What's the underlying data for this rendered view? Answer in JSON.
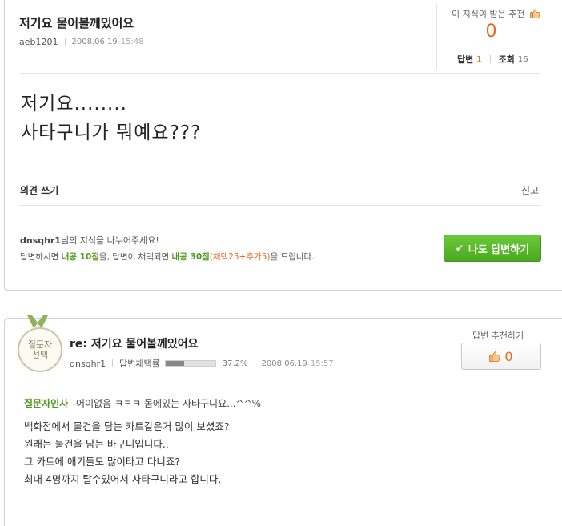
{
  "question": {
    "title": "저기요 물어볼께있어요",
    "author": "aeb1201",
    "date": "2008.06.19",
    "time": "15:48",
    "recommend_label": "이 지식이 받은 추천",
    "recommend_count": "0",
    "answers_label": "답변",
    "answers_count": "1",
    "views_label": "조회",
    "views_count": "16",
    "body_lines": [
      "저기요........",
      "사타구니가 뭐예요???"
    ],
    "opinion_link": "의견 쓰기",
    "report_link": "신고",
    "share_user": "dnsqhr1",
    "share_text": "님의 지식을 나누어주세요!",
    "reward_prefix": "답변하시면",
    "reward_points1": "내공 10점",
    "reward_mid": "을, 답변이 채택되면",
    "reward_points2": "내공 30점",
    "reward_bonus": "(채택25+추가5)",
    "reward_suffix": "을 드립니다.",
    "answer_button": "나도 답변하기"
  },
  "answer": {
    "medal_line1": "질문자",
    "medal_line2": "선택",
    "title": "re: 저기요 물어볼께있어요",
    "author": "dnsqhr1",
    "adoption_label": "답변채택률",
    "adoption_rate": "37.2%",
    "adoption_fraction": 0.372,
    "date": "2008.06.19",
    "time": "15:57",
    "recommend_label": "답변 추천하기",
    "recommend_count": "0",
    "thanks_tag": "질문자인사",
    "thanks_text": "어이없음 ㅋㅋㅋ 몸에있는 사타구니요...^^%",
    "body_lines": [
      "백화점에서 물건을 담는 카트같은거 많이 보셨죠?",
      "원래는 물건을 담는 바구니입니다..",
      "그 카트에 애기들도 많이타고 다니죠?",
      "최대 4명까지 탈수있어서 사타구니라고 합니다."
    ]
  },
  "colors": {
    "accent_orange": "#e8671c",
    "accent_green": "#4f9a1e",
    "button_green": "#5bb82c"
  },
  "icons": [
    "thumbs-up-icon",
    "check-icon",
    "medal-icon"
  ]
}
